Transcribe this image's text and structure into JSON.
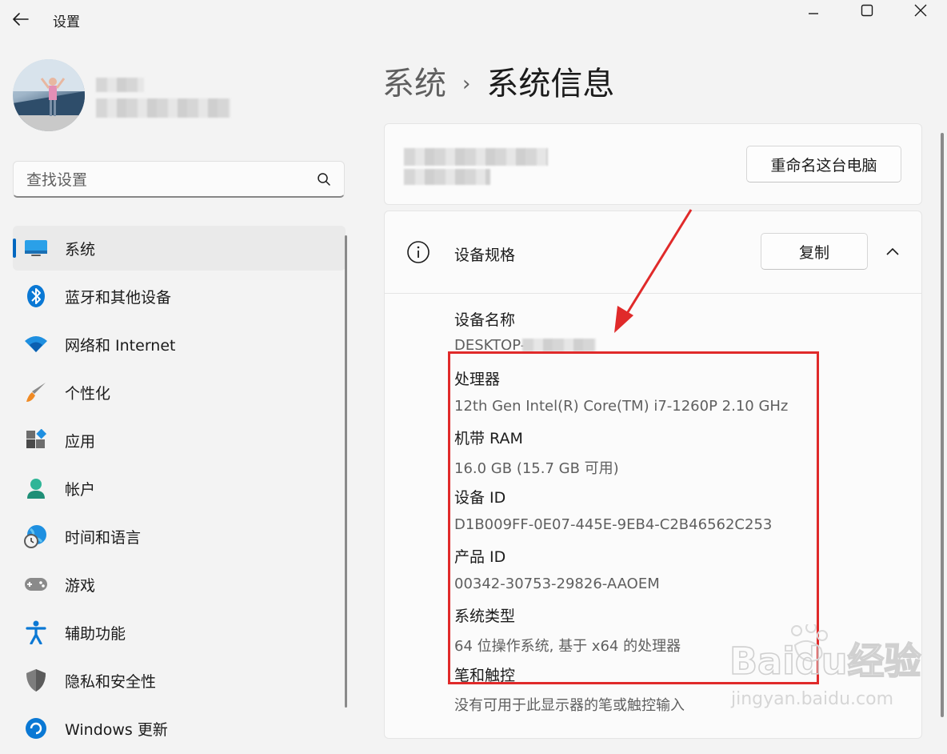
{
  "window": {
    "title": "设置"
  },
  "search": {
    "placeholder": "查找设置"
  },
  "nav": {
    "items": [
      {
        "label": "系统",
        "icon": "display-icon",
        "selected": true
      },
      {
        "label": "蓝牙和其他设备",
        "icon": "bluetooth-icon"
      },
      {
        "label": "网络和 Internet",
        "icon": "wifi-icon"
      },
      {
        "label": "个性化",
        "icon": "brush-icon"
      },
      {
        "label": "应用",
        "icon": "apps-icon"
      },
      {
        "label": "帐户",
        "icon": "account-icon"
      },
      {
        "label": "时间和语言",
        "icon": "globe-clock-icon"
      },
      {
        "label": "游戏",
        "icon": "gamepad-icon"
      },
      {
        "label": "辅助功能",
        "icon": "accessibility-icon"
      },
      {
        "label": "隐私和安全性",
        "icon": "shield-icon"
      },
      {
        "label": "Windows 更新",
        "icon": "update-icon"
      }
    ]
  },
  "breadcrumb": {
    "parent": "系统",
    "separator": "›",
    "current": "系统信息"
  },
  "pc_card": {
    "rename_label": "重命名这台电脑"
  },
  "specs": {
    "title": "设备规格",
    "copy_label": "复制",
    "device_name_label": "设备名称",
    "device_name_value": "DESKTOP-",
    "items": [
      {
        "label": "处理器",
        "value": "12th Gen Intel(R) Core(TM) i7-1260P   2.10 GHz"
      },
      {
        "label": "机带 RAM",
        "value": "16.0 GB (15.7 GB 可用)"
      },
      {
        "label": "设备 ID",
        "value": "D1B009FF-0E07-445E-9EB4-C2B46562C253"
      },
      {
        "label": "产品 ID",
        "value": "00342-30753-29826-AAOEM"
      },
      {
        "label": "系统类型",
        "value": "64 位操作系统, 基于 x64 的处理器"
      },
      {
        "label": "笔和触控",
        "value": "没有可用于此显示器的笔或触控输入"
      }
    ]
  },
  "watermark": {
    "brand": "Baidu经验",
    "url": "jingyan.baidu.com"
  },
  "colors": {
    "accent": "#0067c0",
    "annotation_red": "#e02a2a"
  }
}
